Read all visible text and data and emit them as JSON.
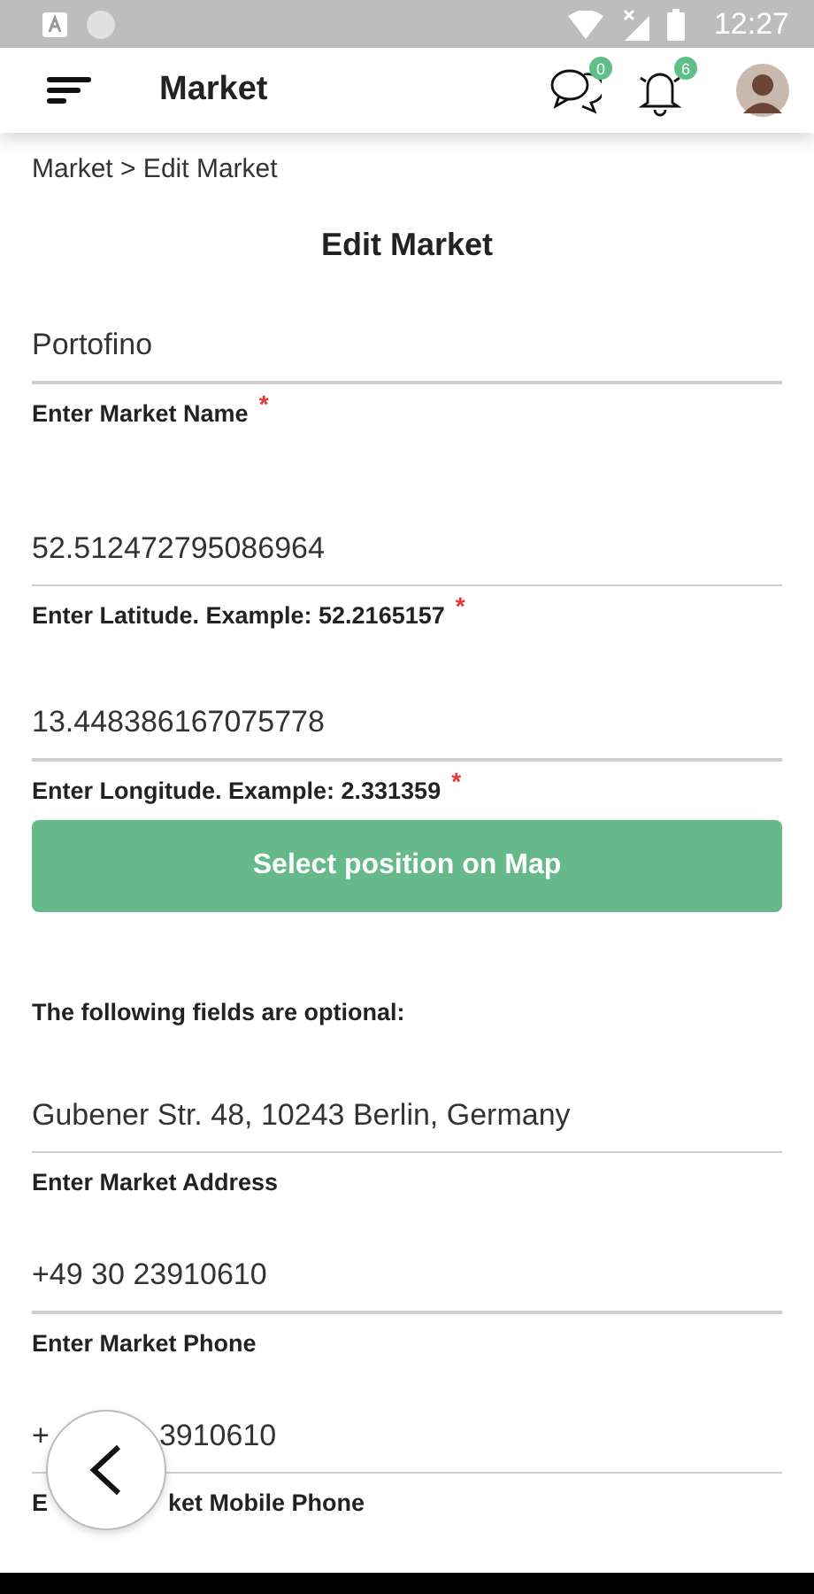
{
  "status_bar": {
    "time": "12:27"
  },
  "header": {
    "title": "Market",
    "messages_badge": "0",
    "notifications_badge": "6"
  },
  "breadcrumb": "Market > Edit Market",
  "page_title": "Edit Market",
  "required_fields": [
    {
      "value": "Portofino",
      "label": "Enter Market Name",
      "required": true,
      "required_mark": "*"
    },
    {
      "value": "52.512472795086964",
      "label": "Enter Latitude. Example: 52.2165157",
      "required": true,
      "required_mark": "*"
    },
    {
      "value": "13.448386167075778",
      "label": "Enter Longitude. Example: 2.331359",
      "required": true,
      "required_mark": "*"
    }
  ],
  "map_button": "Select position on Map",
  "optional_note": "The following fields are optional:",
  "optional_fields": [
    {
      "value": "Gubener Str. 48, 10243 Berlin, Germany",
      "label": "Enter Market Address"
    },
    {
      "value": "+49 30 23910610",
      "label": "Enter Market Phone"
    }
  ],
  "covered_field": {
    "value_start": "+",
    "value_end": "3910610",
    "label_start": "E",
    "label_end": "ket Mobile Phone"
  }
}
